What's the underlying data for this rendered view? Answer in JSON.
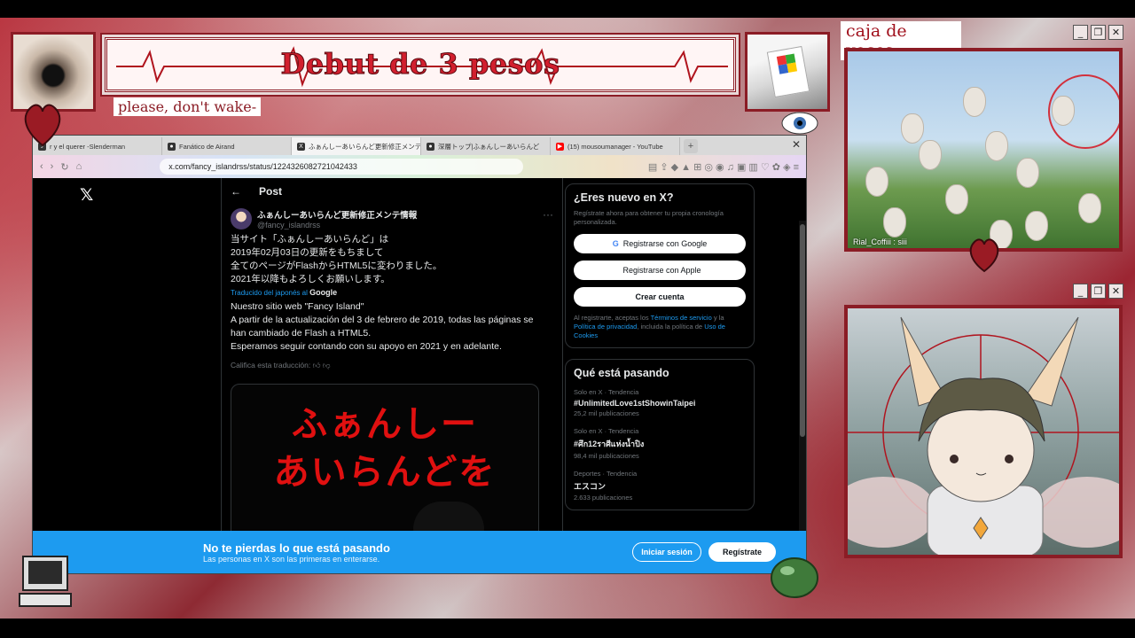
{
  "stream": {
    "banner_title": "Debut de 3 pesos",
    "subtitle": "please, don't wake-",
    "voices_title": "caja de voces",
    "cam_caption": "Rial_Coffiii : siii",
    "window_buttons": [
      "_",
      "❐",
      "✕"
    ]
  },
  "browser": {
    "tabs": [
      {
        "label": "r y el querer -Slenderman",
        "icon": "audio-icon"
      },
      {
        "label": "Fanático de Airand",
        "icon": "page-icon"
      },
      {
        "label": "ふぁんしーあいらんど更新修正メンテ",
        "icon": "x-icon",
        "active": true
      },
      {
        "label": "深層トップ|ふぁんしーあいらんど",
        "icon": "page-icon"
      },
      {
        "label": "(15) mousoumanager - YouTube",
        "icon": "youtube-icon"
      }
    ],
    "url": "x.com/fancy_islandrss/status/1224326082721042433"
  },
  "post": {
    "header": "Post",
    "author_name": "ふぁんしーあいらんど更新修正メンテ情報",
    "author_handle": "@fancy_islandrss",
    "text_lines": [
      "当サイト「ふぁんしーあいらんど」は",
      "2019年02月03日の更新をもちまして",
      "全てのページがFlashからHTML5に変わりました。",
      "2021年以降もよろしくお願いします。"
    ],
    "translated_label": "Traducido del japonés al",
    "translated_provider": "Google",
    "translation_lines": [
      "Nuestro sitio web \"Fancy Island\"",
      "A partir de la actualización del 3 de febrero de 2019, todas las páginas se",
      "han cambiado de Flash a HTML5.",
      "Esperamos seguir contando con su apoyo en 2021 y en adelante."
    ],
    "rate_translation": "Califica esta traducción:",
    "media_line1": "ふぁんしー",
    "media_line2": "あいらんどを"
  },
  "sidebar": {
    "signup_title": "¿Eres nuevo en X?",
    "signup_desc": "Regístrate ahora para obtener tu propia cronología personalizada.",
    "google_btn": "Registrarse con Google",
    "apple_btn": "Registrarse con Apple",
    "create_btn": "Crear cuenta",
    "legal_prefix": "Al registrarte, aceptas los",
    "legal_terms": "Términos de servicio",
    "legal_and": "y la",
    "legal_privacy": "Política de privacidad",
    "legal_mid": ", incluida la política de",
    "legal_cookies": "Uso de Cookies",
    "trends_title": "Qué está pasando",
    "trends": [
      {
        "context": "Solo en X · Tendencia",
        "tag": "#UnlimitedLove1stShowinTaipei",
        "count": "25,2 mil publicaciones"
      },
      {
        "context": "Solo en X · Tendencia",
        "tag": "#ศึก12ราศีแห่งน้ำปิง",
        "count": "98,4 mil publicaciones"
      },
      {
        "context": "Deportes · Tendencia",
        "tag": "エスコン",
        "count": "2.633 publicaciones"
      }
    ]
  },
  "bottom_banner": {
    "title": "No te pierdas lo que está pasando",
    "subtitle": "Las personas en X son las primeras en enterarse.",
    "login": "Iniciar sesión",
    "signup": "Regístrate"
  },
  "colors": {
    "accent": "#8b1c25",
    "x_blue": "#1d9bf0",
    "banner_red": "#d21f2e"
  }
}
